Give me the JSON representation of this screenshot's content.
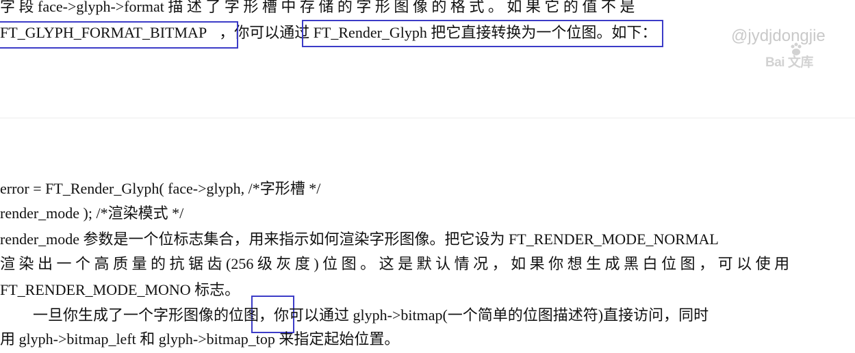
{
  "paragraph1": {
    "line1": "字 段   face->glyph->format   描 述 了 字 形 槽 中 存 储 的 字 形 图 像 的 格 式 。 如 果 它 的 值 不 是",
    "line2_boxed_term": "FT_GLYPH_FORMAT_BITMAP",
    "line2_mid": "，你可以",
    "line2_boxed_phrase": "通过 FT_Render_Glyph 把它直接转换为一个位图",
    "line2_end": "。如下："
  },
  "code": {
    "line1": "error  =  FT_Render_Glyph(  face->glyph,  /*字形槽  */",
    "line2": "render_mode  );  /*渲染模式  */"
  },
  "paragraph2": {
    "line1": "render_mode 参数是一个位标志集合，用来指示如何渲染字形图像。把它设为 FT_RENDER_MODE_NORMAL",
    "line2": "渲 染 出 一 个 高 质 量 的 抗 锯 齿 (256   级 灰 度 ) 位 图 。 这 是 默 认 情 况 ， 如 果 你 想 生 成 黑 白 位 图 ， 可 以 使 用",
    "line3": "FT_RENDER_MODE_MONO 标志。"
  },
  "paragraph3": {
    "line1_start": "一旦你生成了一个字形图像的",
    "line1_boxed": "位图",
    "line1_end": "，你可以通过  glyph->bitmap(一个简单的位图描述符)直接访问，同时",
    "line2": "用 glyph->bitmap_left 和 glyph->bitmap_top 来指定起始位置。"
  },
  "watermark": {
    "handle": "@jydjdongjie",
    "logo": "Bai  文库"
  },
  "colors": {
    "highlight_box": "#3b3bc7",
    "watermark": "#c9c9c9"
  }
}
